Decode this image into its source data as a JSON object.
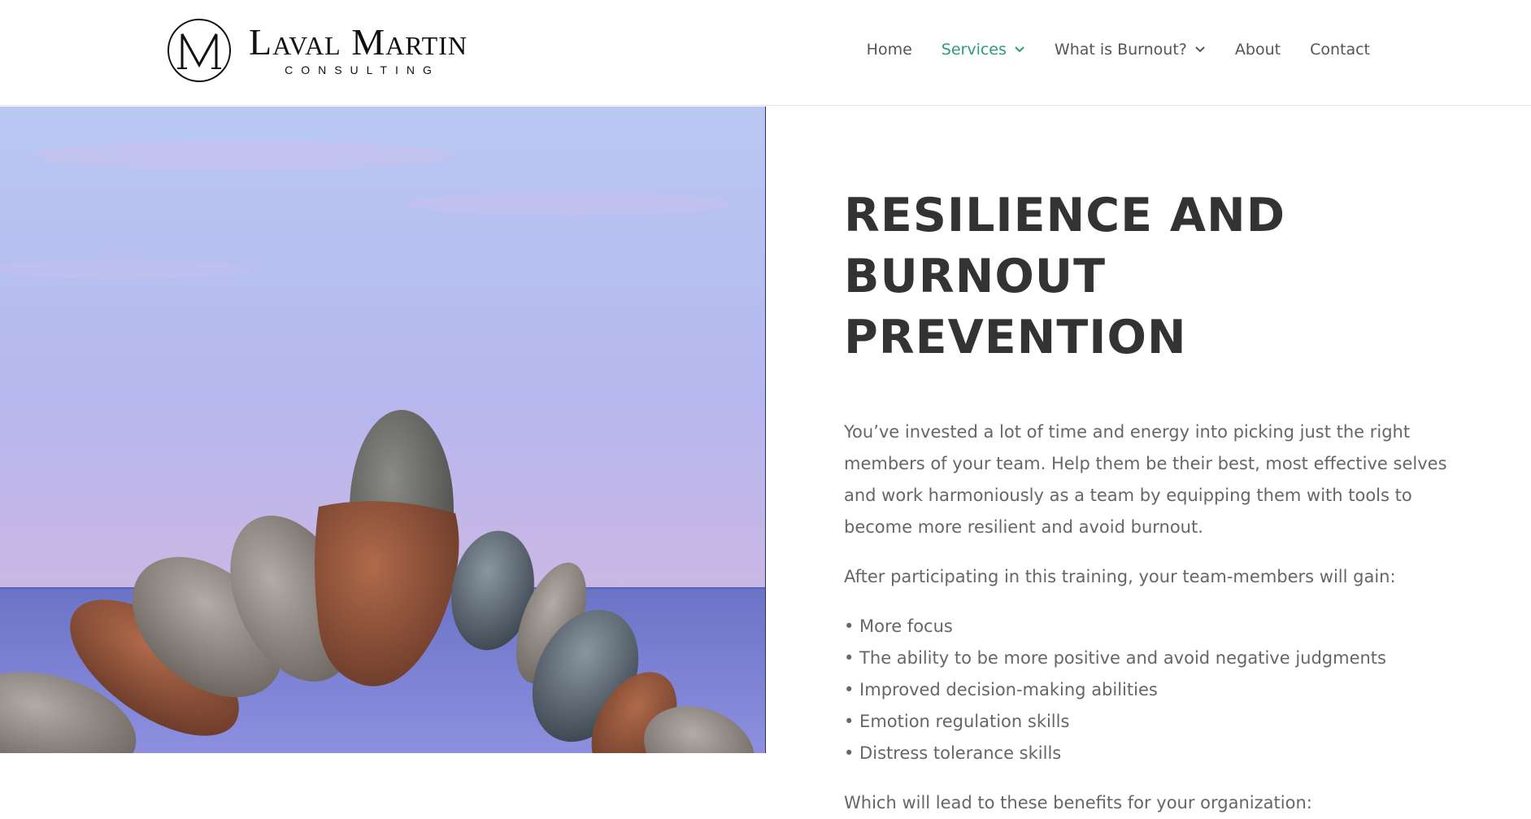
{
  "logo": {
    "name": "Laval Martin",
    "subtitle": "CONSULTING",
    "monogram": "M"
  },
  "nav": {
    "items": [
      {
        "label": "Home",
        "has_dropdown": false,
        "active": false
      },
      {
        "label": "Services",
        "has_dropdown": true,
        "active": true
      },
      {
        "label": "What is Burnout?",
        "has_dropdown": true,
        "active": false
      },
      {
        "label": "About",
        "has_dropdown": false,
        "active": false
      },
      {
        "label": "Contact",
        "has_dropdown": false,
        "active": false
      }
    ],
    "active_color": "#2a9d7b"
  },
  "main": {
    "title_line1": "RESILIENCE AND",
    "title_line2": "BURNOUT PREVENTION",
    "intro": "You’ve invested a lot of time and energy into picking just the right members of your team. Help them be their best, most effective selves and work harmoniously as a team by equipping them with tools to become more resilient and avoid burnout.",
    "lead_in": "After participating in this training, your team-members will gain:",
    "benefits": [
      "• More focus",
      "• The ability to be more positive and avoid negative judgments",
      "• Improved decision-making abilities",
      "• Emotion regulation skills",
      "• Distress tolerance skills"
    ],
    "closing": "Which will lead to these benefits for your organization:"
  },
  "image": {
    "subject": "balanced stone arch by the sea"
  }
}
